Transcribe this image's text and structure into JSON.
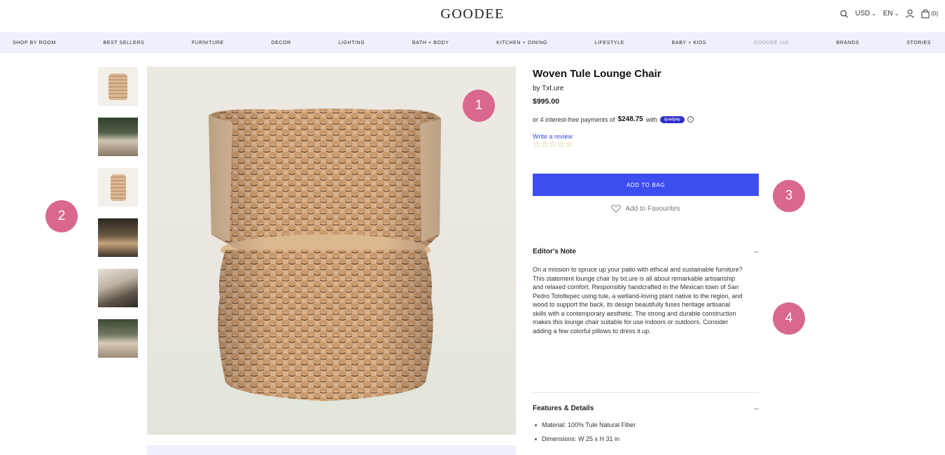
{
  "header": {
    "logo": "GOODEE",
    "currency": "USD",
    "language": "EN",
    "cart_count": "(0)"
  },
  "nav": {
    "items": [
      "SHOP BY ROOM",
      "BEST SELLERS",
      "FURNITURE",
      "DECOR",
      "LIGHTING",
      "BATH + BODY",
      "KITCHEN + DINING",
      "LIFESTYLE",
      "BABY + KIDS",
      "GOODEE 100",
      "BRANDS",
      "STORIES"
    ]
  },
  "product": {
    "title": "Woven Tule Lounge Chair",
    "brand": "by Txt.ure",
    "price": "$995.00",
    "installments_prefix": "or 4 interest-free payments of",
    "installments_amount": "$248.75",
    "installments_suffix": "with",
    "pay_provider": "quadpay",
    "write_review": "Write a review",
    "stars": "☆☆☆☆☆",
    "add_to_bag": "ADD TO BAG",
    "add_to_favourites": "Add to Favourites"
  },
  "editors_note": {
    "heading": "Editor's Note",
    "toggle": "–",
    "body": "On a mission to spruce up your patio with ethical and sustainable furniture? This statement lounge chair by txt.ure is all about remarkable artisanship and relaxed comfort. Responsibly handcrafted in the Mexican town of San Pedro Totoltepec using tule, a wetland-loving plant native to the region, and wood to support the back, its design beautifully fuses heritage artisanal skills with a contemporary aesthetic. The strong and durable construction makes this lounge chair suitable for use indoors or outdoors. Consider adding a few colorful pillows to dress it up."
  },
  "features": {
    "heading": "Features & Details",
    "toggle": "–",
    "items": [
      "Material: 100% Tule Natural Fiber",
      "Dimensions: W 25 x H 31 in"
    ]
  },
  "annotations": {
    "badge1": "1",
    "badge2": "2",
    "badge3": "3",
    "badge4": "4"
  },
  "colors": {
    "accent": "#3d4ef0",
    "badge": "#d9678e",
    "nav_bg": "#eef1fb"
  }
}
